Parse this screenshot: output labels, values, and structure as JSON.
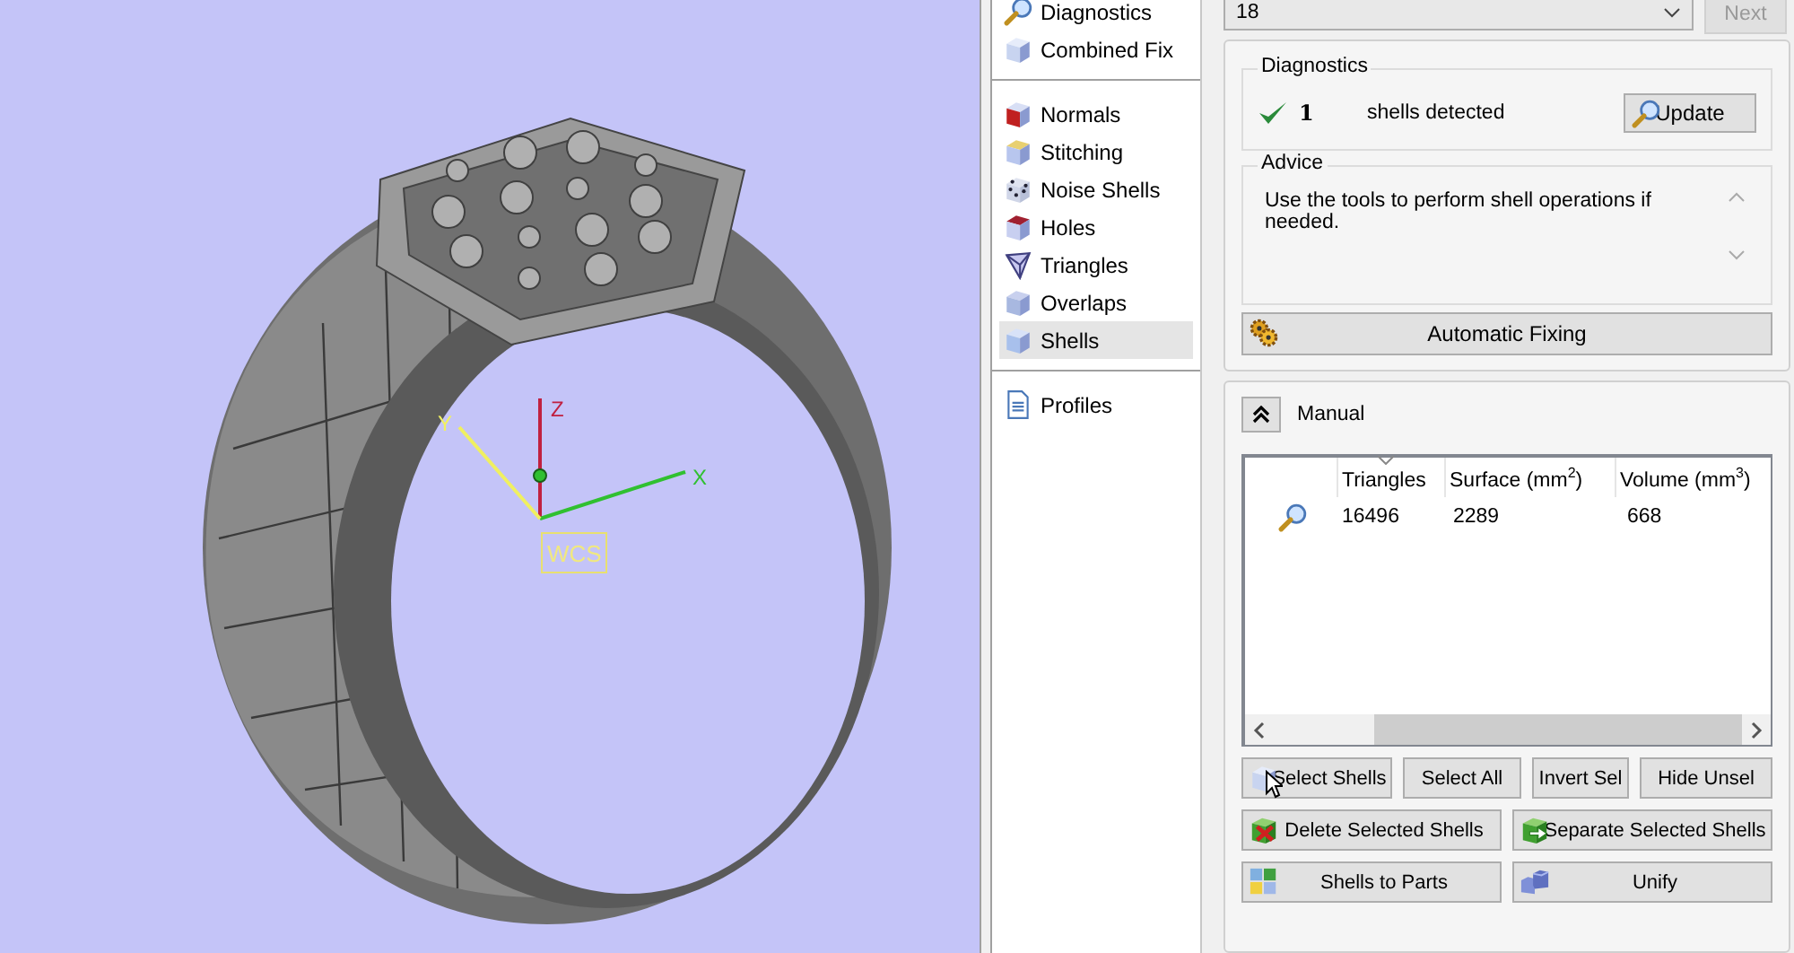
{
  "viewport": {
    "axes": [
      {
        "label": "Z"
      },
      {
        "label": "X"
      },
      {
        "label": "Y"
      }
    ],
    "wcs_label": "WCS"
  },
  "sidebar": {
    "groups": [
      [
        {
          "label": "Diagnostics",
          "selected": false
        },
        {
          "label": "Combined Fix",
          "selected": false
        }
      ],
      [
        {
          "label": "Normals",
          "selected": false
        },
        {
          "label": "Stitching",
          "selected": false
        },
        {
          "label": "Noise Shells",
          "selected": false
        },
        {
          "label": "Holes",
          "selected": false
        },
        {
          "label": "Triangles",
          "selected": false
        },
        {
          "label": "Overlaps",
          "selected": false
        },
        {
          "label": "Shells",
          "selected": true
        }
      ],
      [
        {
          "label": "Profiles",
          "selected": false
        }
      ]
    ]
  },
  "current_part": {
    "value": "18"
  },
  "next_button": {
    "label": "Next",
    "disabled": true
  },
  "diagnostics": {
    "title": "Diagnostics",
    "count": "1",
    "ok": true,
    "text": "shells detected",
    "update_button": "Update"
  },
  "advice": {
    "title": "Advice",
    "text": "Use the tools to perform shell operations if needed."
  },
  "auto_fix_button": "Automatic Fixing",
  "manual": {
    "title": "Manual",
    "expanded": true
  },
  "table": {
    "columns": [
      {
        "label": "Triangles",
        "sorted": true
      },
      {
        "label": "Surface (mm$^{2}$)",
        "sorted": false
      },
      {
        "label": "Volume (mm$^{3}$)",
        "sorted": false
      }
    ],
    "rows": [
      {
        "cells": [
          "16496",
          "2289",
          "668"
        ]
      }
    ]
  },
  "buttons": [
    [
      {
        "label": "Select Shells"
      },
      {
        "label": "Select All"
      },
      {
        "label": "Invert Sel"
      },
      {
        "label": "Hide Unsel"
      }
    ],
    [
      {
        "label": "Delete Selected Shells"
      },
      {
        "label": "Separate Selected Shells"
      }
    ],
    [
      {
        "label": "Shells to Parts"
      },
      {
        "label": "Unify"
      }
    ]
  ]
}
